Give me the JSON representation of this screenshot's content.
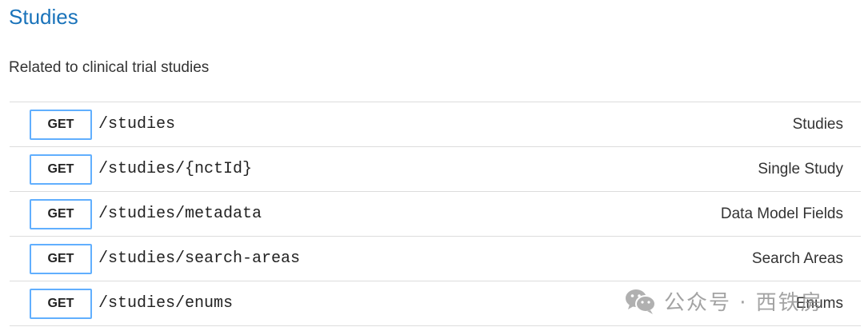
{
  "section": {
    "title": "Studies",
    "description": "Related to clinical trial studies"
  },
  "colors": {
    "title": "#1a73ba",
    "get_border": "#61affe",
    "divider": "#dcdcdc"
  },
  "endpoints": [
    {
      "method": "GET",
      "path": "/studies",
      "summary": "Studies"
    },
    {
      "method": "GET",
      "path": "/studies/{nctId}",
      "summary": "Single Study"
    },
    {
      "method": "GET",
      "path": "/studies/metadata",
      "summary": "Data Model Fields"
    },
    {
      "method": "GET",
      "path": "/studies/search-areas",
      "summary": "Search Areas"
    },
    {
      "method": "GET",
      "path": "/studies/enums",
      "summary": "Enums"
    }
  ],
  "watermark": {
    "icon": "wechat-icon",
    "text": "公众号 · 西铁房"
  }
}
